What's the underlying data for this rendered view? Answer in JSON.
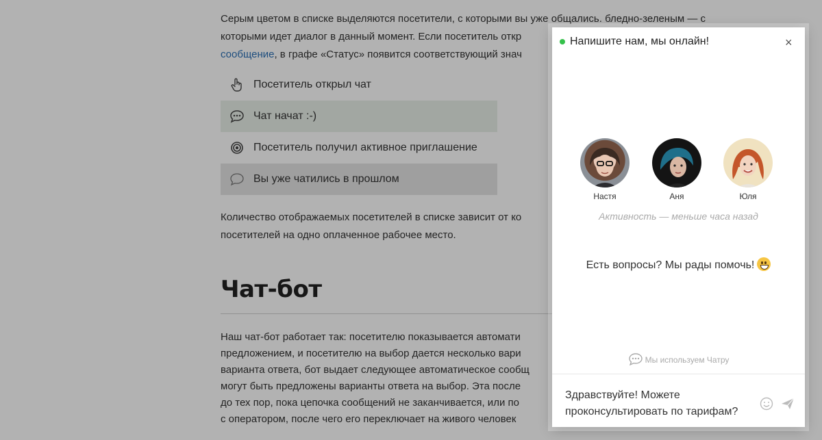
{
  "article": {
    "p1_line1": "Серым цветом в списке выделяются посетители, с которыми вы уже общались. бледно-зеленым — с",
    "p1_line2": "которыми идет диалог в данный момент. Если посетитель откр",
    "p1_link": "сообщение",
    "p1_line3_rest": ", в графе «Статус» появится соответствующий знач",
    "statuses": [
      {
        "label": "Посетитель открыл чат",
        "icon": "pointer-hand-icon"
      },
      {
        "label": "Чат начат :-)",
        "icon": "chat-bubble-dots-icon"
      },
      {
        "label": "Посетитель получил активное приглашение",
        "icon": "target-icon"
      },
      {
        "label": "Вы уже чатились в прошлом",
        "icon": "chat-bubble-outline-icon"
      }
    ],
    "p2_line1": "Количество отображаемых посетителей в списке зависит от ко",
    "p2_line2": "посетителей на одно оплаченное рабочее место.",
    "heading": "Чат-бот",
    "p3_lines": [
      "Наш чат-бот работает так: посетителю показывается автомати",
      "предложением, и посетителю на выбор дается несколько вари",
      "варианта ответа, бот выдает следующее автоматическое сообщ",
      "могут быть предложены варианты ответа на выбор. Эта после",
      "до тех пор, пока цепочка сообщений не заканчивается, или по",
      "с оператором, после чего его переключает на живого человек"
    ]
  },
  "widget": {
    "title": "Напишите нам, мы онлайн!",
    "close": "×",
    "operators": [
      {
        "name": "Настя"
      },
      {
        "name": "Аня"
      },
      {
        "name": "Юля"
      }
    ],
    "activity": "Активность — меньше часа назад",
    "greeting": "Есть вопросы? Мы рады помочь!",
    "powered": "Мы используем Чатру",
    "message": "Здравствуйте! Можете проконсультировать по тарифам?"
  },
  "colors": {
    "online": "#35c14b",
    "link": "#2a6fb5",
    "active_row": "#e9f0e9",
    "past_row": "#e4e4e4"
  }
}
